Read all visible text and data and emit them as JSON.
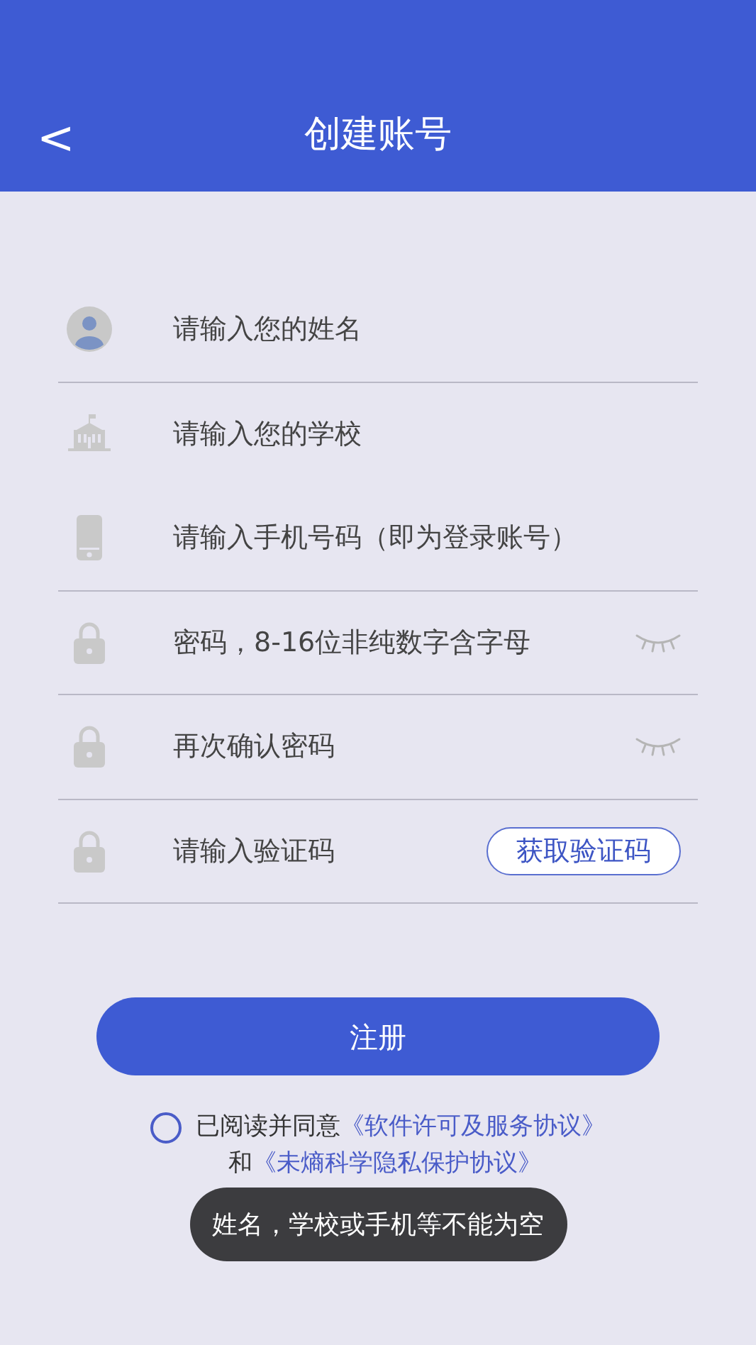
{
  "header": {
    "back": "<",
    "title": "创建账号"
  },
  "fields": [
    {
      "kind": "person",
      "placeholder": "请输入您的姓名",
      "divider": true
    },
    {
      "kind": "school",
      "placeholder": "请输入您的学校",
      "divider": false
    },
    {
      "kind": "phone",
      "placeholder": "请输入手机号码（即为登录账号）",
      "divider": true
    },
    {
      "kind": "lock",
      "placeholder": "密码，8-16位非纯数字含字母",
      "eye_toggle": true,
      "divider": true
    },
    {
      "kind": "lock",
      "placeholder": "再次确认密码",
      "eye_toggle": true,
      "divider": true
    },
    {
      "kind": "lock",
      "placeholder": "请输入验证码",
      "code_button": "获取验证码",
      "divider": true
    }
  ],
  "submit": "注册",
  "agreement": {
    "checked": false,
    "text": "已阅读并同意",
    "link1": "《软件许可及服务协议》",
    "and": "和",
    "link2": "《未熵科学隐私保护协议》"
  },
  "toast": "姓名，学校或手机等不能为空"
}
